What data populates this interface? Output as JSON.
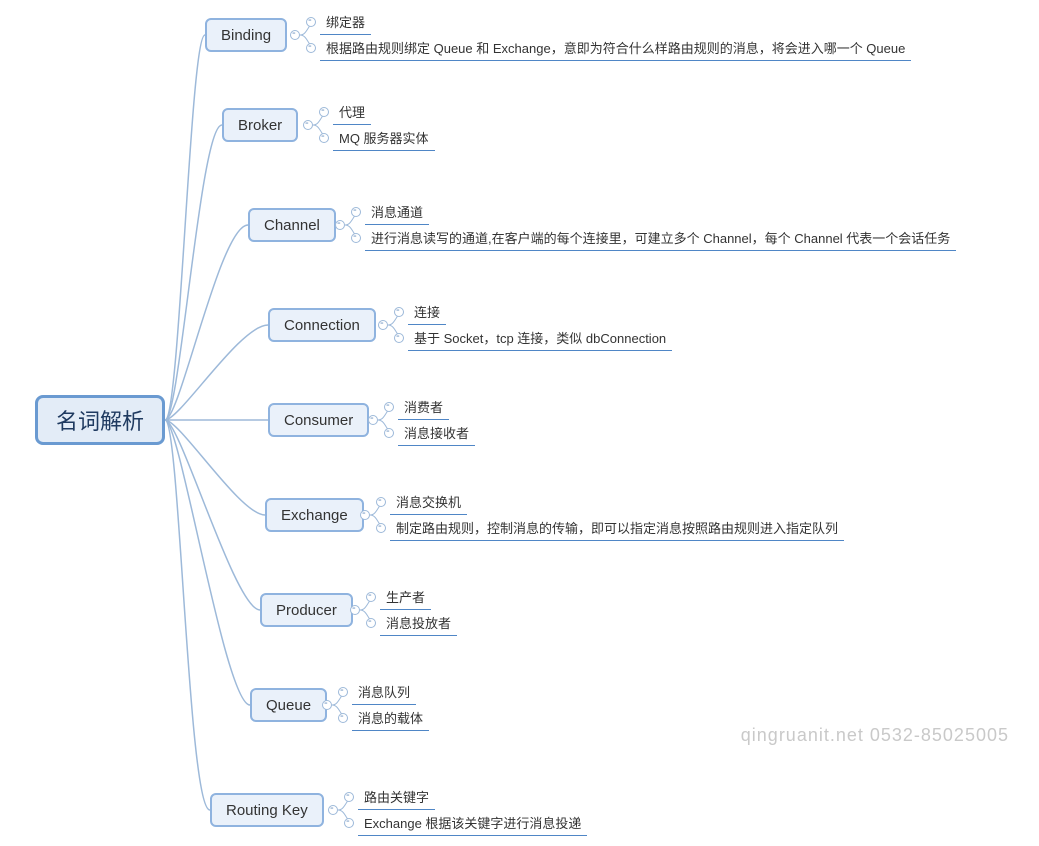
{
  "root": {
    "title": "名词解析"
  },
  "branches": [
    {
      "key": "binding",
      "label": "Binding",
      "children": [
        {
          "text": "绑定器"
        },
        {
          "text": "根据路由规则绑定 Queue 和 Exchange，意即为符合什么样路由规则的消息，将会进入哪一个 Queue"
        }
      ]
    },
    {
      "key": "broker",
      "label": "Broker",
      "children": [
        {
          "text": "代理"
        },
        {
          "text": "MQ 服务器实体"
        }
      ]
    },
    {
      "key": "channel",
      "label": "Channel",
      "children": [
        {
          "text": "消息通道"
        },
        {
          "text": "进行消息读写的通道,在客户端的每个连接里，可建立多个 Channel，每个 Channel 代表一个会话任务"
        }
      ]
    },
    {
      "key": "connection",
      "label": "Connection",
      "children": [
        {
          "text": "连接"
        },
        {
          "text": "基于 Socket，tcp 连接，类似 dbConnection"
        }
      ]
    },
    {
      "key": "consumer",
      "label": "Consumer",
      "children": [
        {
          "text": "消费者"
        },
        {
          "text": "消息接收者"
        }
      ]
    },
    {
      "key": "exchange",
      "label": "Exchange",
      "children": [
        {
          "text": "消息交换机"
        },
        {
          "text": "制定路由规则，控制消息的传输，即可以指定消息按照路由规则进入指定队列"
        }
      ]
    },
    {
      "key": "producer",
      "label": "Producer",
      "children": [
        {
          "text": "生产者"
        },
        {
          "text": "消息投放者"
        }
      ]
    },
    {
      "key": "queue",
      "label": "Queue",
      "children": [
        {
          "text": "消息队列"
        },
        {
          "text": "消息的载体"
        }
      ]
    },
    {
      "key": "routingkey",
      "label": "Routing Key",
      "children": [
        {
          "text": "路由关键字"
        },
        {
          "text": "Exchange 根据该关键字进行消息投递"
        }
      ]
    }
  ],
  "watermark": "qingruanit.net 0532-85025005"
}
